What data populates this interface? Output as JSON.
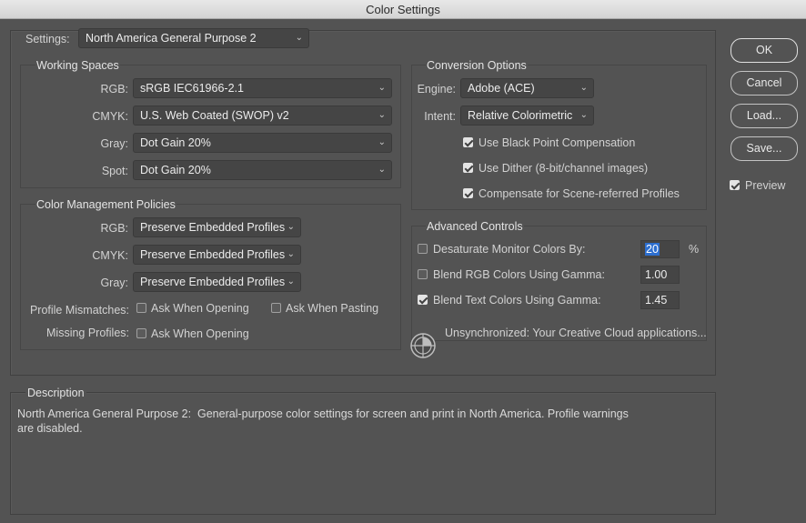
{
  "window": {
    "title": "Color Settings"
  },
  "settings": {
    "label": "Settings:",
    "value": "North America General Purpose 2"
  },
  "working_spaces": {
    "title": "Working Spaces",
    "rgb": {
      "label": "RGB:",
      "value": "sRGB IEC61966-2.1"
    },
    "cmyk": {
      "label": "CMYK:",
      "value": "U.S. Web Coated (SWOP) v2"
    },
    "gray": {
      "label": "Gray:",
      "value": "Dot Gain 20%"
    },
    "spot": {
      "label": "Spot:",
      "value": "Dot Gain 20%"
    }
  },
  "policies": {
    "title": "Color Management Policies",
    "rgb": {
      "label": "RGB:",
      "value": "Preserve Embedded Profiles"
    },
    "cmyk": {
      "label": "CMYK:",
      "value": "Preserve Embedded Profiles"
    },
    "gray": {
      "label": "Gray:",
      "value": "Preserve Embedded Profiles"
    },
    "mismatch_label": "Profile Mismatches:",
    "mismatch_opening": {
      "label": "Ask When Opening",
      "checked": false
    },
    "mismatch_pasting": {
      "label": "Ask When Pasting",
      "checked": false
    },
    "missing_label": "Missing Profiles:",
    "missing_opening": {
      "label": "Ask When Opening",
      "checked": false
    }
  },
  "conversion": {
    "title": "Conversion Options",
    "engine": {
      "label": "Engine:",
      "value": "Adobe (ACE)"
    },
    "intent": {
      "label": "Intent:",
      "value": "Relative Colorimetric"
    },
    "black_point": {
      "label": "Use Black Point Compensation",
      "checked": true
    },
    "dither": {
      "label": "Use Dither (8-bit/channel images)",
      "checked": true
    },
    "scene": {
      "label": "Compensate for Scene-referred Profiles",
      "checked": true
    }
  },
  "advanced": {
    "title": "Advanced Controls",
    "desaturate": {
      "label": "Desaturate Monitor Colors By:",
      "value": "20",
      "unit": "%",
      "checked": false
    },
    "blend_rgb": {
      "label": "Blend RGB Colors Using Gamma:",
      "value": "1.00",
      "checked": false
    },
    "blend_text": {
      "label": "Blend Text Colors Using Gamma:",
      "value": "1.45",
      "checked": true
    }
  },
  "sync": {
    "icon": "sync-globe-icon",
    "text": "Unsynchronized: Your Creative Cloud applications..."
  },
  "description": {
    "title": "Description",
    "text": "North America General Purpose 2:  General-purpose color settings for screen and print in North America. Profile warnings\nare disabled."
  },
  "buttons": {
    "ok": "OK",
    "cancel": "Cancel",
    "load": "Load...",
    "save": "Save..."
  },
  "preview": {
    "label": "Preview",
    "checked": true
  },
  "colors": {
    "background": "#535353",
    "selection": "#2d6fd0"
  }
}
